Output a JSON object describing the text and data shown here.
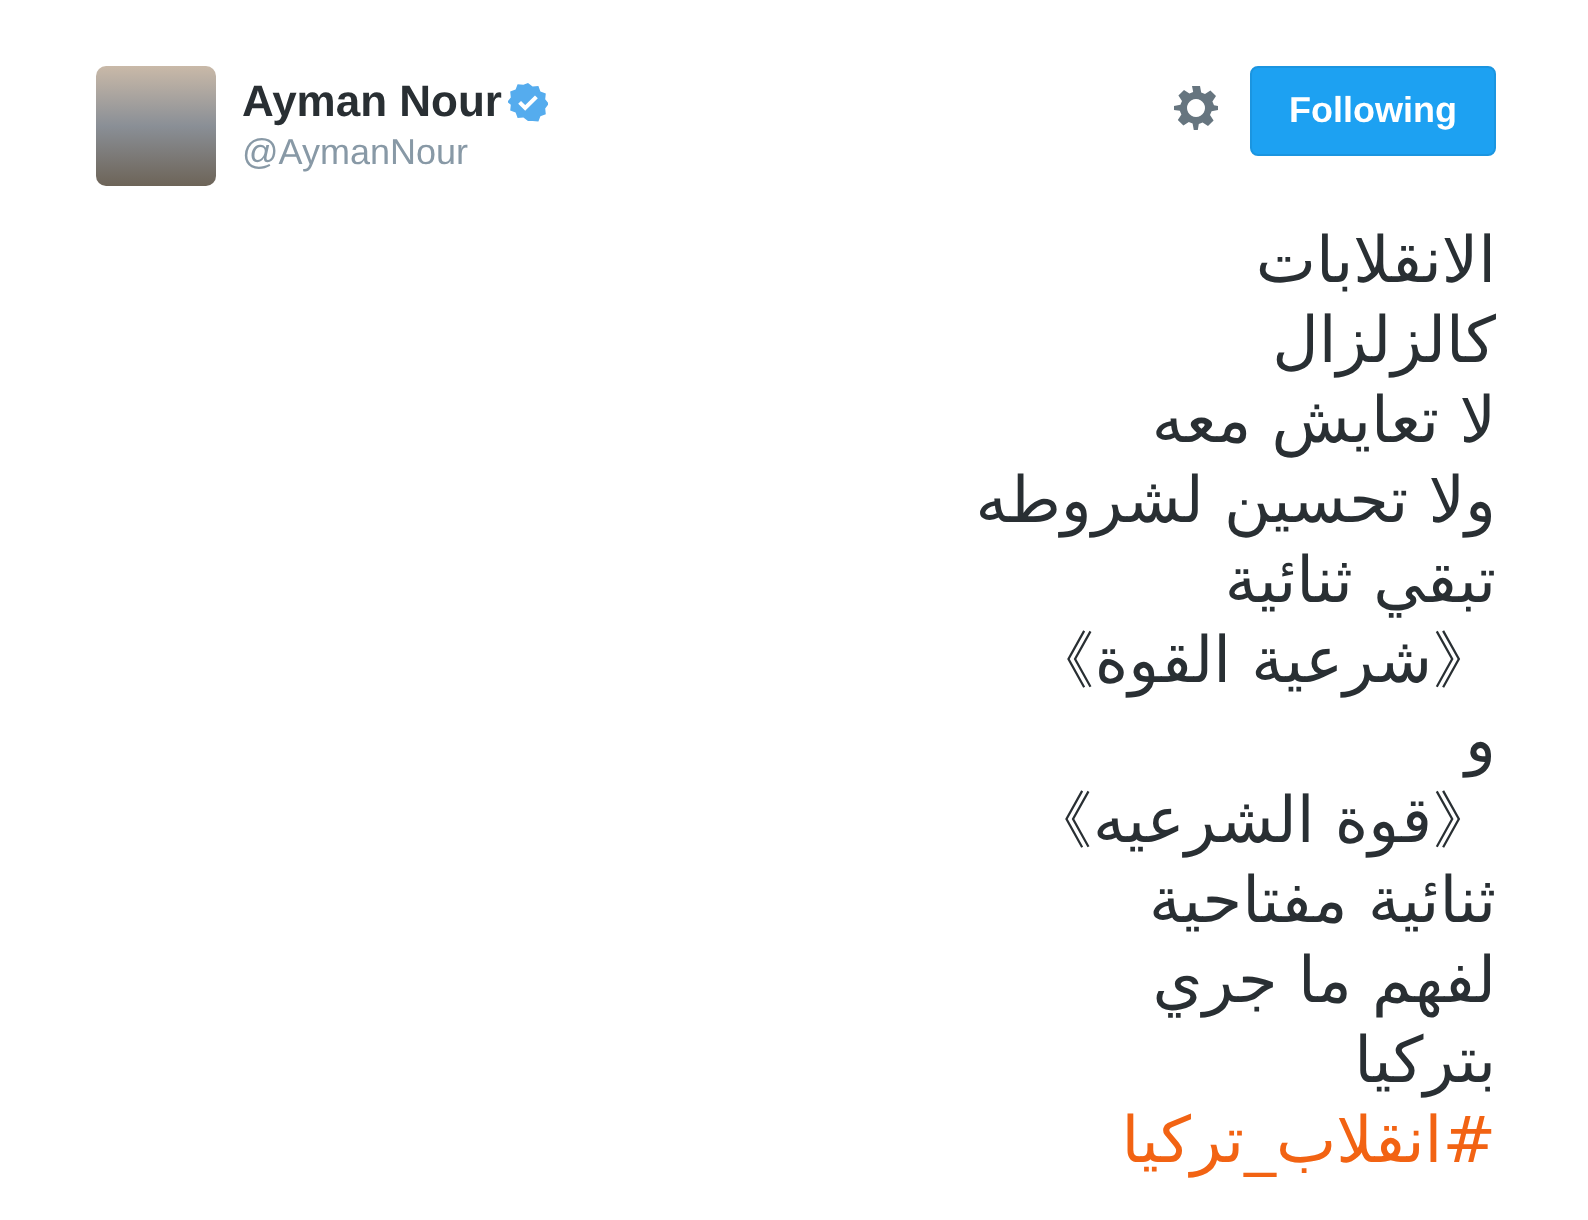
{
  "author": {
    "name": "Ayman Nour",
    "handle": "@AymanNour",
    "verified": true
  },
  "follow_button": {
    "label": "Following",
    "selected": true
  },
  "tweet": {
    "lines": [
      {
        "kind": "text",
        "text": "الانقلابات"
      },
      {
        "kind": "text",
        "text": "كالزلزال"
      },
      {
        "kind": "text",
        "text": "لا تعايش معه"
      },
      {
        "kind": "text",
        "text": "ولا تحسين لشروطه"
      },
      {
        "kind": "text",
        "text": "تبقي ثنائية"
      },
      {
        "kind": "text",
        "text": "《شرعية القوة》"
      },
      {
        "kind": "text",
        "text": "و"
      },
      {
        "kind": "text",
        "text": "《قوة الشرعيه》"
      },
      {
        "kind": "text",
        "text": "ثنائية مفتاحية"
      },
      {
        "kind": "text",
        "text": "لفهم ما جري"
      },
      {
        "kind": "text",
        "text": "بتركيا"
      },
      {
        "kind": "hashtag",
        "text": "#انقلاب_تركيا"
      }
    ]
  }
}
